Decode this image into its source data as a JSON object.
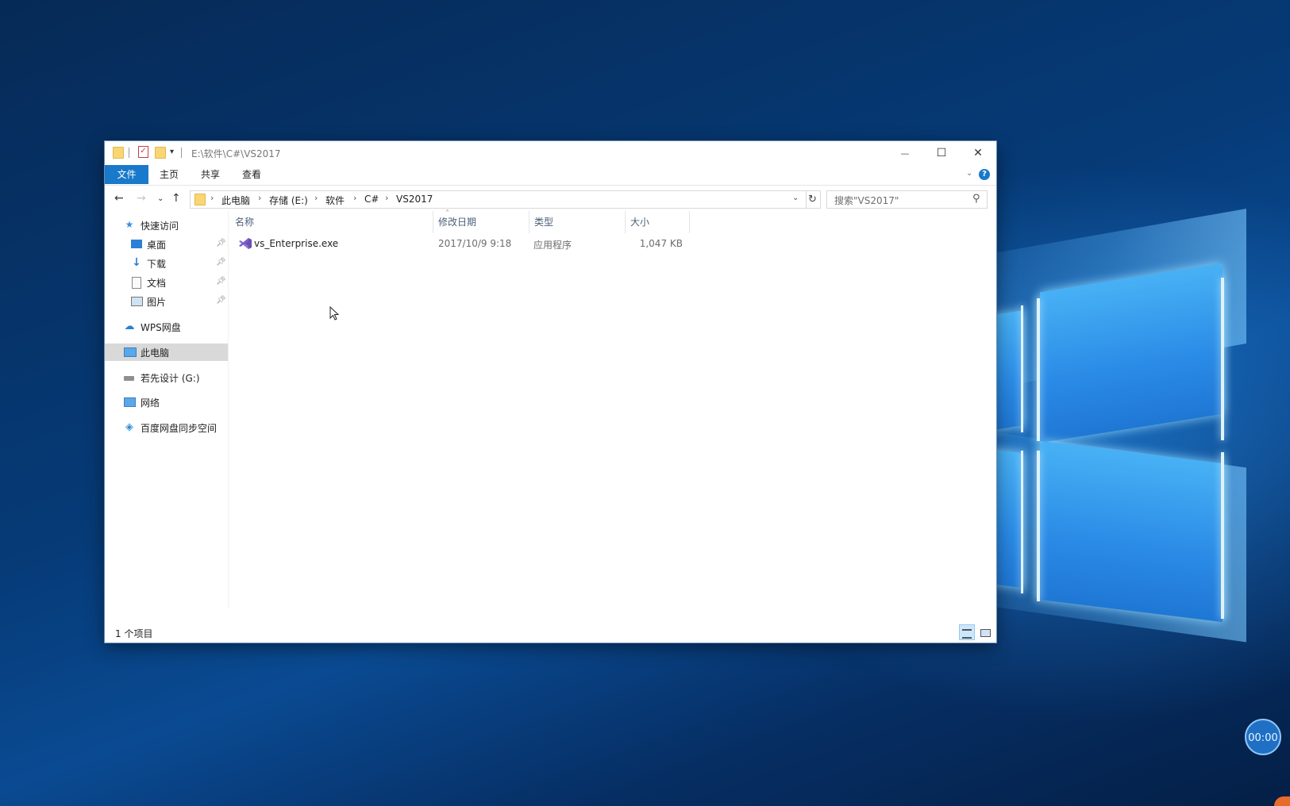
{
  "window": {
    "title_path": "E:\\软件\\C#\\VS2017",
    "controls": {
      "minimize": "—",
      "maximize": "☐",
      "close": "✕"
    }
  },
  "ribbon": {
    "tabs": [
      "文件",
      "主页",
      "共享",
      "查看"
    ],
    "help": "?",
    "active_color": "#1979ca"
  },
  "address": {
    "crumbs": [
      "此电脑",
      "存储 (E:)",
      "软件",
      "C#",
      "VS2017"
    ],
    "separator": "›"
  },
  "search": {
    "placeholder": "搜索\"VS2017\""
  },
  "sidebar": {
    "items": [
      {
        "label": "快速访问",
        "icon": "star-icon",
        "pinned": false
      },
      {
        "label": "桌面",
        "icon": "desktop-icon",
        "pinned": true
      },
      {
        "label": "下载",
        "icon": "download-icon",
        "pinned": true
      },
      {
        "label": "文档",
        "icon": "document-icon",
        "pinned": true
      },
      {
        "label": "图片",
        "icon": "picture-icon",
        "pinned": true
      },
      {
        "label": "WPS网盘",
        "icon": "cloud-icon",
        "pinned": false
      },
      {
        "label": "此电脑",
        "icon": "computer-icon",
        "pinned": false,
        "selected": true
      },
      {
        "label": "若先设计 (G:)",
        "icon": "drive-icon",
        "pinned": false
      },
      {
        "label": "网络",
        "icon": "network-icon",
        "pinned": false
      },
      {
        "label": "百度网盘同步空间",
        "icon": "baidu-icon",
        "pinned": false
      }
    ]
  },
  "columns": [
    "名称",
    "修改日期",
    "类型",
    "大小"
  ],
  "files": [
    {
      "name": "vs_Enterprise.exe",
      "modified": "2017/10/9 9:18",
      "type": "应用程序",
      "size": "1,047 KB",
      "icon": "visual-studio-icon"
    }
  ],
  "status": {
    "count_text": "1 个项目"
  },
  "overlay": {
    "timer": "00:00"
  }
}
